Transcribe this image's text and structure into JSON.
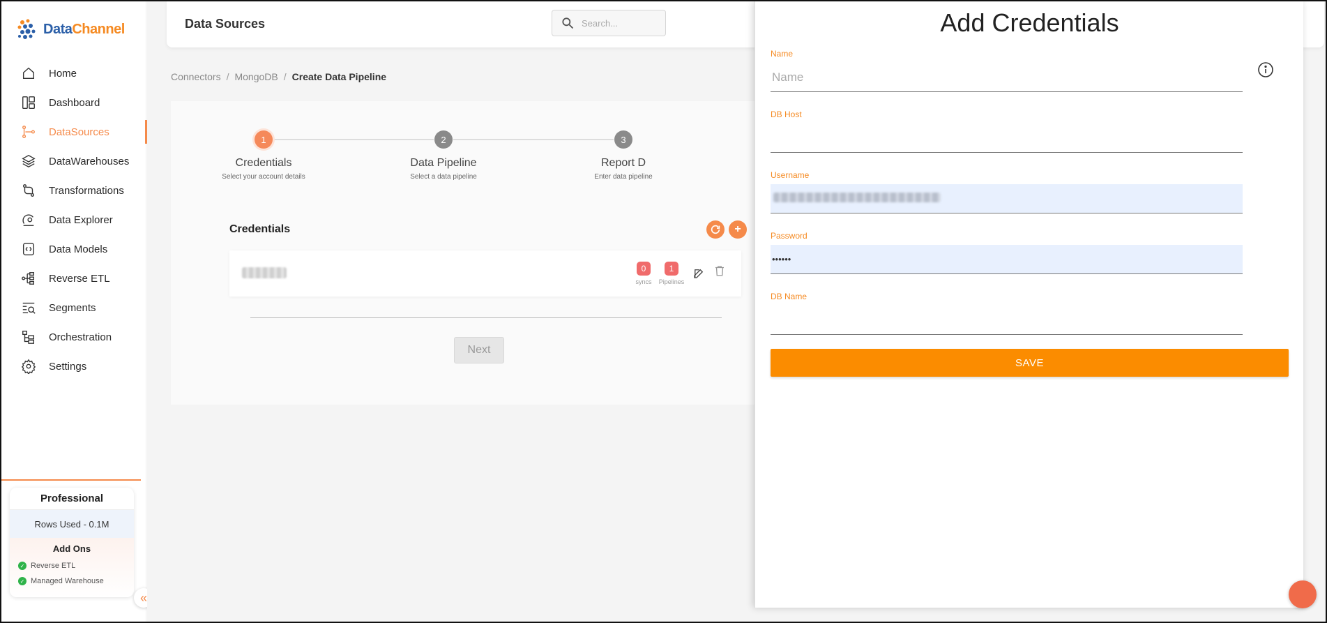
{
  "brand": {
    "name_part1": "Data",
    "name_part2": "Channel"
  },
  "sidebar": {
    "items": [
      {
        "label": "Home",
        "icon": "home-icon"
      },
      {
        "label": "Dashboard",
        "icon": "dashboard-icon"
      },
      {
        "label": "DataSources",
        "icon": "datasources-icon",
        "active": true
      },
      {
        "label": "DataWarehouses",
        "icon": "layers-icon"
      },
      {
        "label": "Transformations",
        "icon": "transformations-icon"
      },
      {
        "label": "Data Explorer",
        "icon": "explorer-icon"
      },
      {
        "label": "Data Models",
        "icon": "models-icon"
      },
      {
        "label": "Reverse ETL",
        "icon": "reverse-etl-icon"
      },
      {
        "label": "Segments",
        "icon": "segments-icon"
      },
      {
        "label": "Orchestration",
        "icon": "orchestration-icon"
      },
      {
        "label": "Settings",
        "icon": "gear-icon"
      }
    ],
    "plan": {
      "name": "Professional",
      "rows_used": "Rows Used - 0.1M",
      "addons_title": "Add Ons",
      "addons": [
        "Reverse ETL",
        "Managed Warehouse"
      ]
    },
    "collapse_glyph": "«"
  },
  "header": {
    "title": "Data Sources",
    "search_placeholder": "Search..."
  },
  "breadcrumb": [
    "Connectors",
    "MongoDB",
    "Create Data Pipeline"
  ],
  "stepper": {
    "steps": [
      {
        "num": "1",
        "title": "Credentials",
        "sub": "Select your account details"
      },
      {
        "num": "2",
        "title": "Data Pipeline",
        "sub": "Select a data pipeline"
      },
      {
        "num": "3",
        "title": "Report D",
        "sub": "Enter data pipeline"
      }
    ]
  },
  "credentials": {
    "heading": "Credentials",
    "syncs_count": "0",
    "syncs_label": "syncs",
    "pipelines_count": "1",
    "pipelines_label": "Pipelines"
  },
  "next_label": "Next",
  "drawer": {
    "title": "Add Credentials",
    "fields": [
      {
        "label": "Name",
        "placeholder": "Name",
        "value": ""
      },
      {
        "label": "DB Host",
        "placeholder": "",
        "value": ""
      },
      {
        "label": "Username",
        "placeholder": "",
        "value": ""
      },
      {
        "label": "Password",
        "placeholder": "",
        "value": "••••••"
      },
      {
        "label": "DB Name",
        "placeholder": "",
        "value": ""
      }
    ],
    "save_label": "SAVE"
  },
  "colors": {
    "accent": "#f58a4a",
    "save": "#fb8c00",
    "autofill": "#e8f0fe"
  }
}
